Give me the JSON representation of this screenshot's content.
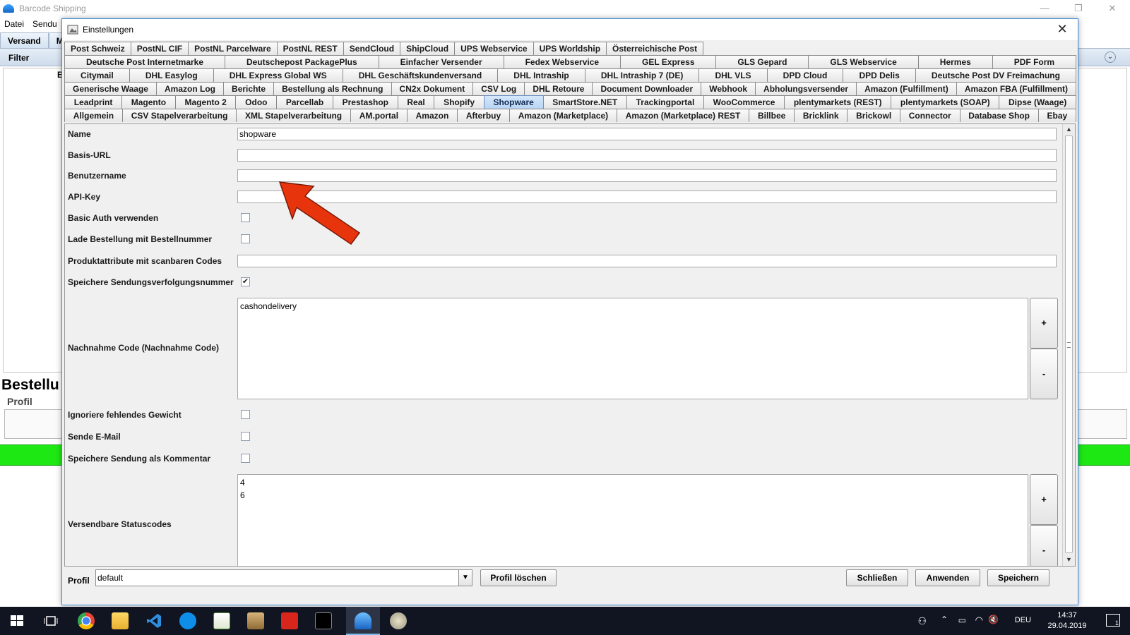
{
  "app": {
    "title": "Barcode Shipping",
    "menu": [
      "Datei",
      "Sendu"
    ],
    "tabs": [
      "Versand",
      "M"
    ],
    "filter_label": "Filter",
    "panel_partial_label": "B",
    "section_title": "Bestellu",
    "profile_label": "Profil",
    "window_controls": {
      "minimize": "—",
      "restore": "❐",
      "close": "✕"
    }
  },
  "dialog": {
    "title": "Einstellungen",
    "close_glyph": "✕",
    "tab_rows": [
      [
        "Post Schweiz",
        "PostNL CIF",
        "PostNL Parcelware",
        "PostNL REST",
        "SendCloud",
        "ShipCloud",
        "UPS Webservice",
        "UPS Worldship",
        "Österreichische Post"
      ],
      [
        "Deutsche Post Internetmarke",
        "Deutschepost PackagePlus",
        "Einfacher Versender",
        "Fedex Webservice",
        "GEL Express",
        "GLS Gepard",
        "GLS Webservice",
        "Hermes",
        "PDF Form"
      ],
      [
        "Citymail",
        "DHL Easylog",
        "DHL Express Global WS",
        "DHL Geschäftskundenversand",
        "DHL Intraship",
        "DHL Intraship 7 (DE)",
        "DHL VLS",
        "DPD Cloud",
        "DPD Delis",
        "Deutsche Post DV Freimachung"
      ],
      [
        "Generische Waage",
        "Amazon Log",
        "Berichte",
        "Bestellung als Rechnung",
        "CN2x Dokument",
        "CSV Log",
        "DHL Retoure",
        "Document Downloader",
        "Webhook",
        "Abholungsversender",
        "Amazon (Fulfillment)",
        "Amazon FBA (Fulfillment)"
      ],
      [
        "Leadprint",
        "Magento",
        "Magento 2",
        "Odoo",
        "Parcellab",
        "Prestashop",
        "Real",
        "Shopify",
        "Shopware",
        "SmartStore.NET",
        "Trackingportal",
        "WooCommerce",
        "plentymarkets (REST)",
        "plentymarkets (SOAP)",
        "Dipse (Waage)"
      ],
      [
        "Allgemein",
        "CSV Stapelverarbeitung",
        "XML Stapelverarbeitung",
        "AM.portal",
        "Amazon",
        "Afterbuy",
        "Amazon (Marketplace)",
        "Amazon (Marketplace) REST",
        "Billbee",
        "Bricklink",
        "Brickowl",
        "Connector",
        "Database Shop",
        "Ebay"
      ]
    ],
    "selected_tab": "Shopware",
    "fields": {
      "name": {
        "label": "Name",
        "value": "shopware"
      },
      "basis_url": {
        "label": "Basis-URL",
        "value": ""
      },
      "benutzername": {
        "label": "Benutzername",
        "value": ""
      },
      "api_key": {
        "label": "API-Key",
        "value": ""
      },
      "basic_auth": {
        "label": "Basic Auth verwenden",
        "checked": false
      },
      "lade_bestellung": {
        "label": "Lade Bestellung mit Bestellnummer",
        "checked": false
      },
      "produktattribute": {
        "label": "Produktattribute mit scanbaren Codes",
        "value": ""
      },
      "speichere_tracking": {
        "label": "Speichere Sendungsverfolgungsnummer",
        "checked": true
      },
      "nachnahme_code": {
        "label": "Nachnahme Code (Nachnahme Code)",
        "items": [
          "cashondelivery"
        ]
      },
      "ignoriere_gewicht": {
        "label": "Ignoriere fehlendes Gewicht",
        "checked": false
      },
      "sende_email": {
        "label": "Sende E-Mail",
        "checked": false
      },
      "speichere_kommentar": {
        "label": "Speichere Sendung als Kommentar",
        "checked": false
      },
      "versendbare_statuscodes": {
        "label": "Versendbare Statuscodes",
        "items": [
          "4",
          "6"
        ]
      }
    },
    "list_buttons": {
      "add": "+",
      "remove": "-"
    },
    "checkmark": "✔",
    "bottom": {
      "profil_label": "Profil",
      "profil_value": "default",
      "profil_loeschen": "Profil löschen",
      "schliessen": "Schließen",
      "anwenden": "Anwenden",
      "speichern": "Speichern"
    },
    "annotation_arrow_color": "#e8340c"
  },
  "taskbar": {
    "language": "DEU",
    "time": "14:37",
    "date": "29.04.2019",
    "notification_count": "1"
  }
}
